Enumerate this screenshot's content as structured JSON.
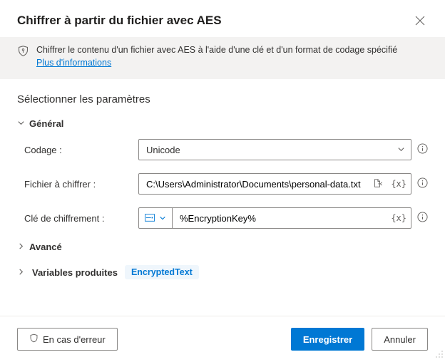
{
  "header": {
    "title": "Chiffrer à partir du fichier avec AES"
  },
  "banner": {
    "text": "Chiffrer le contenu d'un fichier avec AES à l'aide d'une clé et d'un format de codage spécifié",
    "link": "Plus d'informations"
  },
  "section": {
    "title": "Sélectionner les paramètres"
  },
  "groups": {
    "general": "Général",
    "advanced": "Avancé",
    "produced": "Variables produites"
  },
  "fields": {
    "encoding": {
      "label": "Codage :",
      "value": "Unicode"
    },
    "file": {
      "label": "Fichier à chiffrer :",
      "value": "C:\\Users\\Administrator\\Documents\\personal-data.txt"
    },
    "key": {
      "label": "Clé de chiffrement :",
      "value": "%EncryptionKey%"
    }
  },
  "produced_var": "EncryptedText",
  "footer": {
    "on_error": "En cas d'erreur",
    "save": "Enregistrer",
    "cancel": "Annuler"
  }
}
